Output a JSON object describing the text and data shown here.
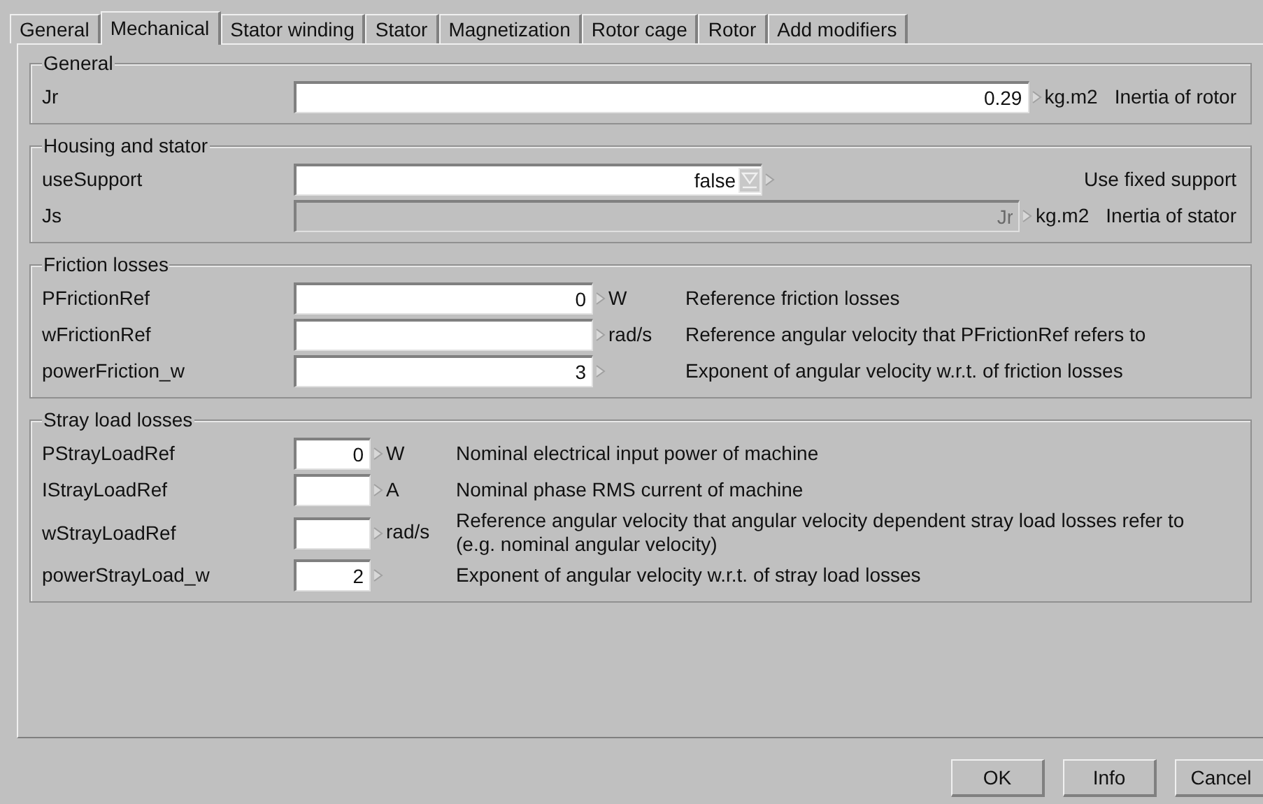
{
  "tabs": [
    {
      "label": "General",
      "selected": false
    },
    {
      "label": "Mechanical",
      "selected": true
    },
    {
      "label": "Stator winding",
      "selected": false
    },
    {
      "label": "Stator",
      "selected": false
    },
    {
      "label": "Magnetization",
      "selected": false
    },
    {
      "label": "Rotor cage",
      "selected": false
    },
    {
      "label": "Rotor",
      "selected": false
    },
    {
      "label": "Add modifiers",
      "selected": false
    }
  ],
  "groups": [
    {
      "title": "General",
      "rows": [
        {
          "kind": "input",
          "label": "Jr",
          "value": "0.29",
          "unit": "kg.m2",
          "description": "Inertia of rotor"
        }
      ]
    },
    {
      "title": "Housing and stator",
      "rows": [
        {
          "kind": "select",
          "label": "useSupport",
          "value": "false",
          "description": "Use fixed support"
        },
        {
          "kind": "input",
          "label": "Js",
          "placeholder": "Jr",
          "disabled": true,
          "unit": "kg.m2",
          "description": "Inertia of stator"
        }
      ]
    },
    {
      "title": "Friction losses",
      "rows": [
        {
          "kind": "input",
          "label": "PFrictionRef",
          "value": "0",
          "unit": "W",
          "description": "Reference friction losses"
        },
        {
          "kind": "input",
          "label": "wFrictionRef",
          "unit": "rad/s",
          "description": "Reference angular velocity that PFrictionRef refers to"
        },
        {
          "kind": "input",
          "label": "powerFriction_w",
          "value": "3",
          "description": "Exponent of angular velocity w.r.t. of friction losses"
        }
      ]
    },
    {
      "title": "Stray load losses",
      "rows": [
        {
          "kind": "input",
          "label": "PStrayLoadRef",
          "value": "0",
          "unit": "W",
          "description": "Nominal electrical input power of machine"
        },
        {
          "kind": "input",
          "label": "IStrayLoadRef",
          "unit": "A",
          "description": "Nominal phase RMS current of machine"
        },
        {
          "kind": "input",
          "label": "wStrayLoadRef",
          "unit": "rad/s",
          "description": "Reference angular velocity that angular velocity dependent stray load losses refer to (e.g. nominal angular velocity)"
        },
        {
          "kind": "input",
          "label": "powerStrayLoad_w",
          "value": "2",
          "description": "Exponent of angular velocity w.r.t. of stray load losses"
        }
      ]
    }
  ],
  "buttons": [
    "OK",
    "Info",
    "Cancel"
  ]
}
